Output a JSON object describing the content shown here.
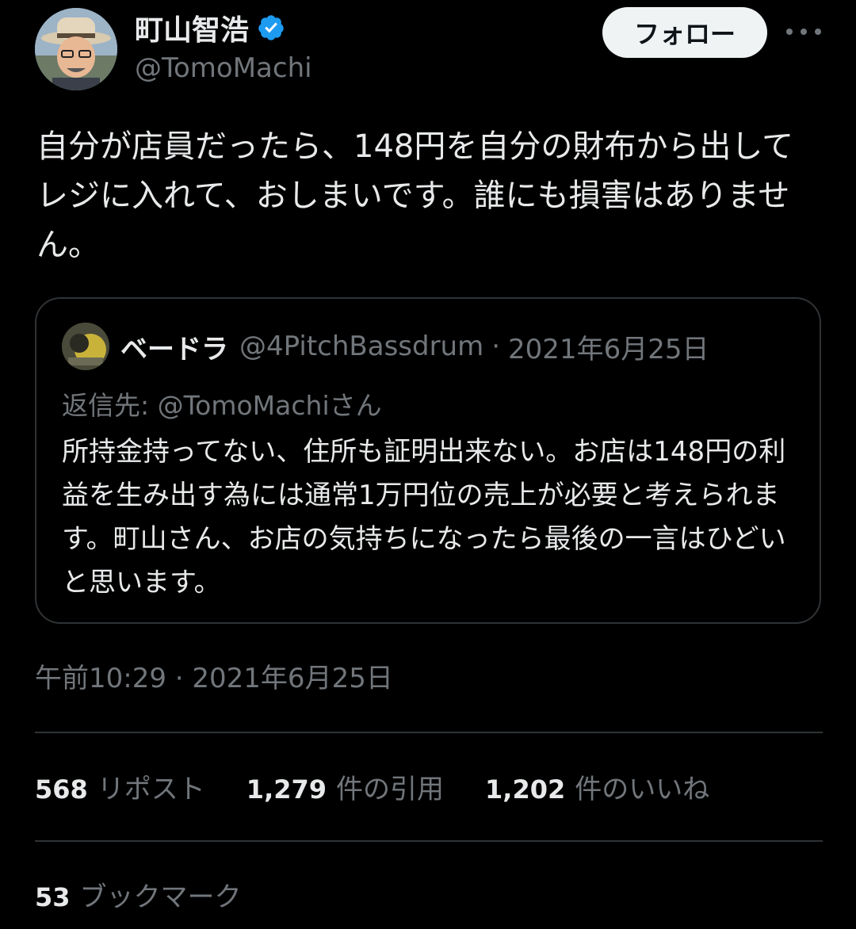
{
  "author": {
    "display_name": "町山智浩",
    "handle": "@TomoMachi",
    "verified_icon": "verified-badge-icon",
    "avatar_icon": "avatar"
  },
  "header": {
    "follow_label": "フォロー",
    "more_icon": "more-options-icon"
  },
  "tweet": {
    "text": "自分が店員だったら、148円を自分の財布から出してレジに入れて、おしまいです。誰にも損害はありません。",
    "timestamp": "午前10:29 · 2021年6月25日"
  },
  "quote": {
    "display_name": "ベードラ",
    "handle": "@4PitchBassdrum",
    "separator": "·",
    "date": "2021年6月25日",
    "reply_to_prefix": "返信先: ",
    "reply_to_handle": "@TomoMachiさん",
    "text": "所持金持ってない、住所も証明出来ない。お店は148円の利益を生み出す為には通常1万円位の売上が必要と考えられます。町山さん、お店の気持ちになったら最後の一言はひどいと思います。"
  },
  "stats": {
    "reposts_count": "568",
    "reposts_label": "リポスト",
    "quotes_count": "1,279",
    "quotes_label": "件の引用",
    "likes_count": "1,202",
    "likes_label": "件のいいね",
    "bookmarks_count": "53",
    "bookmarks_label": "ブックマーク"
  },
  "colors": {
    "background": "#000000",
    "text_primary": "#e7e9ea",
    "text_secondary": "#71767b",
    "border": "#2f3336",
    "verified_blue": "#1d9bf0",
    "follow_button_bg": "#eff3f4"
  }
}
